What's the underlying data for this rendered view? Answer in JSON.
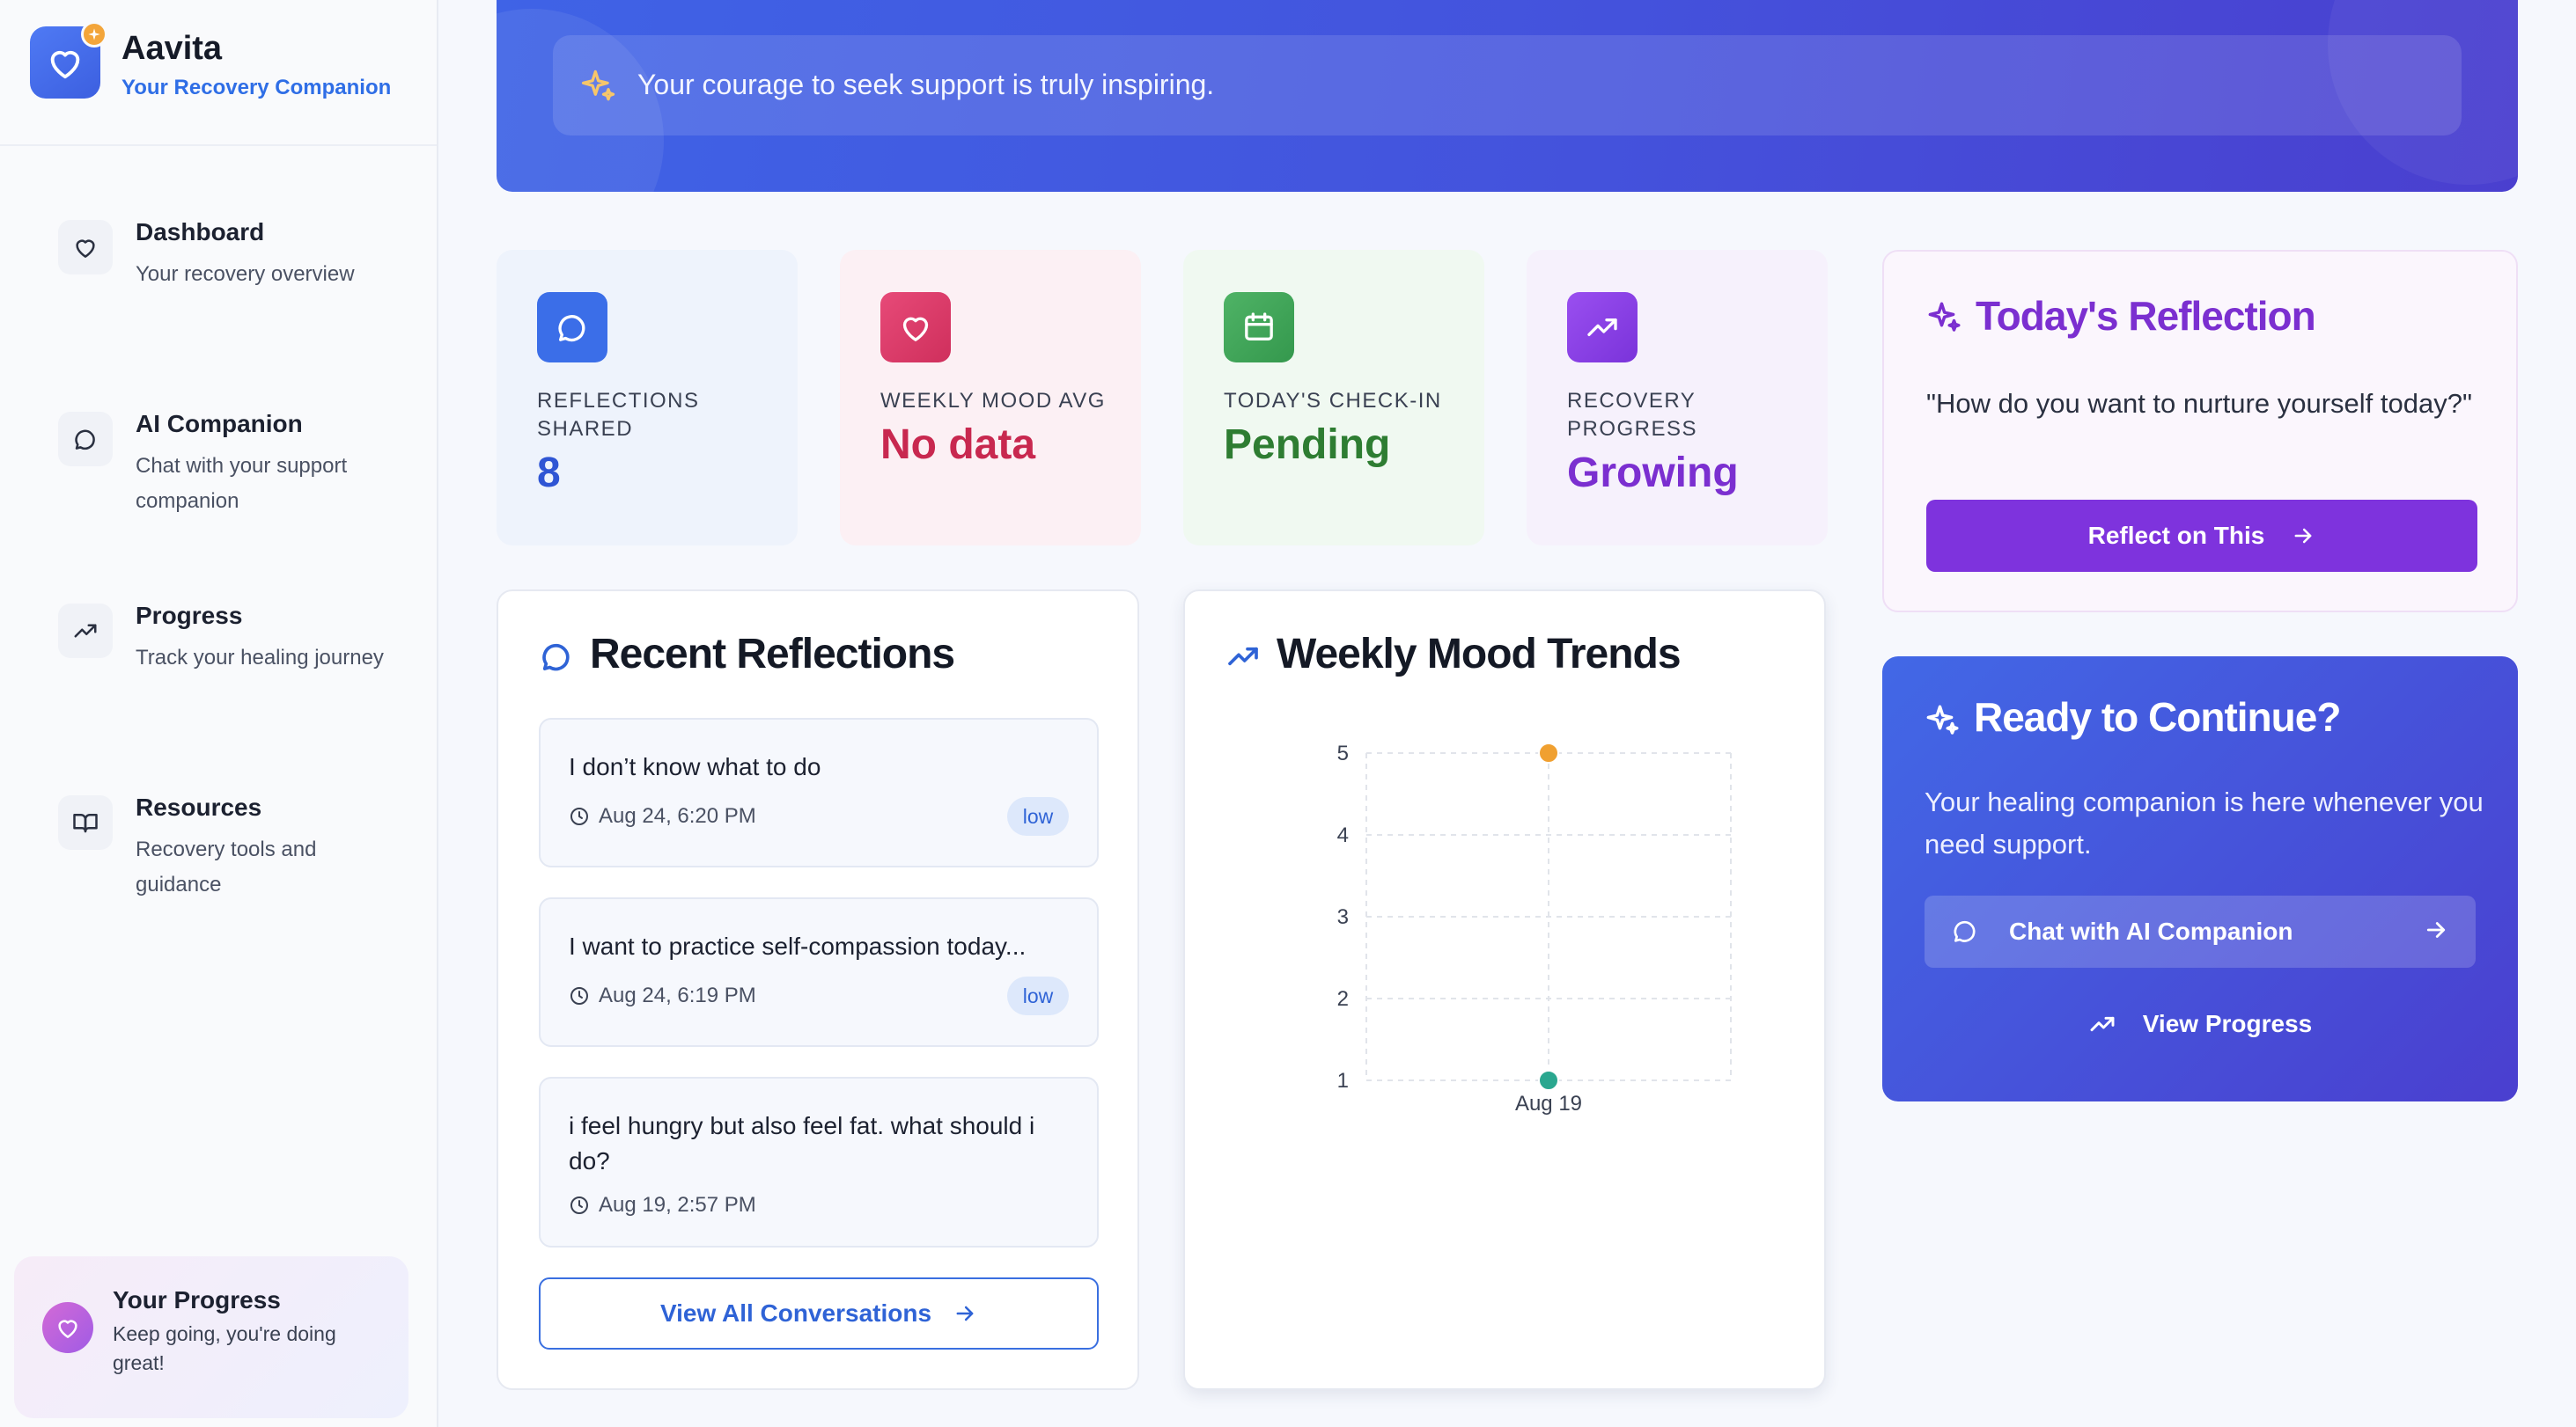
{
  "brand": {
    "name": "Aavita",
    "tagline": "Your Recovery Companion"
  },
  "sidebar": {
    "items": [
      {
        "title": "Dashboard",
        "desc": "Your recovery overview",
        "icon": "heart-icon"
      },
      {
        "title": "AI Companion",
        "desc": "Chat with your support companion",
        "icon": "chat-bubble-icon"
      },
      {
        "title": "Progress",
        "desc": "Track your healing journey",
        "icon": "trending-up-icon"
      },
      {
        "title": "Resources",
        "desc": "Recovery tools and guidance",
        "icon": "book-open-icon"
      }
    ],
    "progress_card": {
      "title": "Your Progress",
      "desc": "Keep going, you're doing great!"
    }
  },
  "banner": {
    "quote": "Your courage to seek support is truly inspiring."
  },
  "stats": [
    {
      "label": "REFLECTIONS SHARED",
      "value": "8",
      "color": "#2f55d4",
      "icon": "chat-bubble-icon"
    },
    {
      "label": "WEEKLY MOOD AVG",
      "value": "No data",
      "color": "#c8284f",
      "icon": "heart-icon"
    },
    {
      "label": "TODAY'S CHECK-IN",
      "value": "Pending",
      "color": "#2e7d32",
      "icon": "calendar-icon"
    },
    {
      "label": "RECOVERY PROGRESS",
      "value": "Growing",
      "color": "#7b2fd0",
      "icon": "trending-up-icon"
    }
  ],
  "reflections": {
    "title": "Recent Reflections",
    "items": [
      {
        "text": "I don’t know what to do",
        "time": "Aug 24, 6:20 PM",
        "badge": "low"
      },
      {
        "text": "I want to practice self-compassion today...",
        "time": "Aug 24, 6:19 PM",
        "badge": "low"
      },
      {
        "text": "i feel hungry but also feel fat. what should i do?",
        "time": "Aug 19, 2:57 PM"
      }
    ],
    "view_all": "View All Conversations"
  },
  "mood": {
    "title": "Weekly Mood Trends"
  },
  "chart_data": {
    "type": "scatter",
    "title": "Weekly Mood Trends",
    "xlabel": "",
    "ylabel": "",
    "x": [
      "Aug 19"
    ],
    "ylim": [
      1,
      5
    ],
    "yticks": [
      1,
      2,
      3,
      4,
      5
    ],
    "grid": true,
    "series": [
      {
        "x": "Aug 19",
        "y": 5,
        "color": "#f0a030"
      },
      {
        "x": "Aug 19",
        "y": 1,
        "color": "#2aa78f"
      }
    ]
  },
  "today": {
    "title": "Today's Reflection",
    "quote": "\"How do you want to nurture yourself today?\"",
    "button": "Reflect on This"
  },
  "continue": {
    "title": "Ready to Continue?",
    "desc": "Your healing companion is here whenever you need support.",
    "chat_button": "Chat with AI Companion",
    "progress_link": "View Progress"
  },
  "colors": {
    "primary": "#3f63e6",
    "purple": "#7e33dd",
    "accent": "#f3a53a"
  }
}
